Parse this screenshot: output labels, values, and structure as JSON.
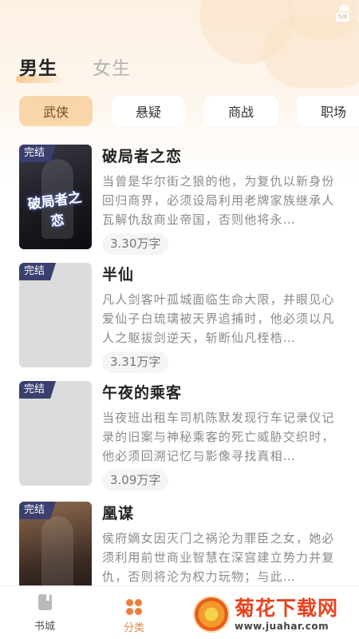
{
  "status_bar": {
    "battery_label": "5/4"
  },
  "gender_tabs": [
    {
      "label": "男生",
      "active": true
    },
    {
      "label": "女生",
      "active": false
    }
  ],
  "categories": [
    {
      "label": "武侠",
      "active": true
    },
    {
      "label": "悬疑",
      "active": false
    },
    {
      "label": "商战",
      "active": false
    },
    {
      "label": "职场",
      "active": false
    }
  ],
  "books": [
    {
      "status": "完结",
      "title": "破局者之恋",
      "desc": "当曾是华尔街之狼的他，为复仇以新身份回归商界，必须设局利用老牌家族继承人瓦解仇敌商业帝国，否则他将永…",
      "word_count": "3.30万字",
      "cover_text": "破局者之恋"
    },
    {
      "status": "完结",
      "title": "半仙",
      "desc": "凡人剑客叶孤城面临生命大限，并眼见心爱仙子白琉璃被天界追捕时，他必须以凡人之躯拔剑逆天，斩断仙凡桎梏…",
      "word_count": "3.31万字"
    },
    {
      "status": "完结",
      "title": "午夜的乘客",
      "desc": "当夜班出租车司机陈默发现行车记录仪记录的旧案与神秘乘客的死亡威胁交织时，他必须回溯记忆与影像寻找真相…",
      "word_count": "3.09万字"
    },
    {
      "status": "完结",
      "title": "凰谋",
      "desc": "侯府嫡女因灭门之祸沦为罪臣之女，她必须利用前世商业智慧在深宫建立势力并复仇，否则将沦为权力玩物；与此…",
      "word_count": ""
    }
  ],
  "bottom_nav": [
    {
      "label": "书城",
      "icon": "book-icon",
      "active": false
    },
    {
      "label": "分类",
      "icon": "clover-icon",
      "active": true
    }
  ],
  "watermark": {
    "name": "菊花下载网",
    "url": "www.juahar.com",
    "icon": "chrysanthemum-logo"
  },
  "colors": {
    "accent": "#ef7e3c",
    "active_chip": "#f8d6a9",
    "status_tag": "#3a3f6e"
  }
}
